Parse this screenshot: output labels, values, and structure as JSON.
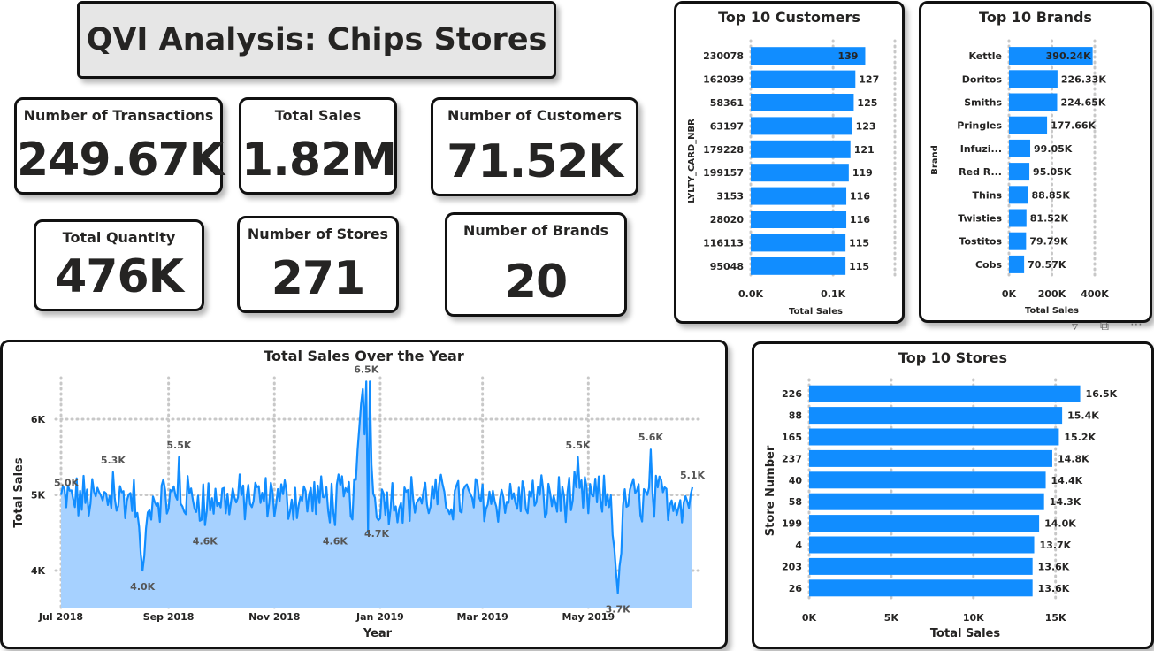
{
  "header": {
    "title": "QVI Analysis: Chips Stores"
  },
  "kpis": {
    "transactions": {
      "label": "Number of Transactions",
      "value": "249.67K"
    },
    "sales": {
      "label": "Total Sales",
      "value": "1.82M"
    },
    "customers": {
      "label": "Number of Customers",
      "value": "71.52K"
    },
    "quantity": {
      "label": "Total Quantity",
      "value": "476K"
    },
    "stores": {
      "label": "Number of Stores",
      "value": "271"
    },
    "brands": {
      "label": "Number of Brands",
      "value": "20"
    }
  },
  "colors": {
    "bar": "#118DFF",
    "area": "#A6D1FF",
    "grid": "#C8C8C8",
    "text": "#252423",
    "border": "#111111"
  },
  "icons": [
    "filter-icon",
    "focus-mode-icon",
    "more-options-icon"
  ],
  "chart_data": [
    {
      "id": "top_customers",
      "type": "bar",
      "orientation": "horizontal",
      "title": "Top 10 Customers",
      "xlabel": "Total Sales",
      "ylabel": "LYLTY_CARD_NBR",
      "categories": [
        "230078",
        "162039",
        "58361",
        "63197",
        "179228",
        "199157",
        "3153",
        "28020",
        "116113",
        "95048"
      ],
      "values": [
        139,
        127,
        125,
        123,
        121,
        119,
        116,
        116,
        115,
        115
      ],
      "labels": [
        "139",
        "127",
        "125",
        "123",
        "121",
        "119",
        "116",
        "116",
        "115",
        "115"
      ],
      "xticks": [
        "0.0K",
        "0.1K"
      ],
      "xlim": [
        0,
        175
      ]
    },
    {
      "id": "top_brands",
      "type": "bar",
      "orientation": "horizontal",
      "title": "Top 10 Brands",
      "xlabel": "Total Sales",
      "ylabel": "Brand",
      "categories": [
        "Kettle",
        "Doritos",
        "Smiths",
        "Pringles",
        "Infuzi...",
        "Red R...",
        "Thins",
        "Twisties",
        "Tostitos",
        "Cobs"
      ],
      "values": [
        390240,
        226330,
        224650,
        177660,
        99050,
        95050,
        88850,
        81520,
        79790,
        70570
      ],
      "labels": [
        "390.24K",
        "226.33K",
        "224.65K",
        "177.66K",
        "99.05K",
        "95.05K",
        "88.85K",
        "81.52K",
        "79.79K",
        "70.57K"
      ],
      "xticks": [
        "0K",
        "200K",
        "400K"
      ],
      "xlim": [
        0,
        400000
      ]
    },
    {
      "id": "sales_over_year",
      "type": "area",
      "title": "Total Sales Over the Year",
      "xlabel": "Year",
      "ylabel": "Total Sales",
      "xticks": [
        "Jul 2018",
        "Sep 2018",
        "Nov 2018",
        "Jan 2019",
        "Mar 2019",
        "May 2019"
      ],
      "yticks": [
        "4K",
        "5K",
        "6K"
      ],
      "ylim": [
        3500,
        6900
      ],
      "date_range": [
        "2018-07-01",
        "2019-06-30"
      ],
      "annotations": [
        {
          "date": "2018-07-01",
          "label": "5.0K",
          "value": 5000
        },
        {
          "date": "2018-07-31",
          "label": "5.3K",
          "value": 5300
        },
        {
          "date": "2018-08-17",
          "label": "4.0K",
          "value": 4000
        },
        {
          "date": "2018-09-07",
          "label": "5.5K",
          "value": 5500
        },
        {
          "date": "2018-09-22",
          "label": "4.6K",
          "value": 4600
        },
        {
          "date": "2018-12-06",
          "label": "4.6K",
          "value": 4600
        },
        {
          "date": "2018-12-24",
          "label": "6.5K",
          "value": 6500
        },
        {
          "date": "2018-12-30",
          "label": "4.7K",
          "value": 4700
        },
        {
          "date": "2019-04-25",
          "label": "5.5K",
          "value": 5500
        },
        {
          "date": "2019-05-18",
          "label": "3.7K",
          "value": 3700
        },
        {
          "date": "2019-06-06",
          "label": "5.6K",
          "value": 5600
        },
        {
          "date": "2019-06-30",
          "label": "5.1K",
          "value": 5100
        }
      ]
    },
    {
      "id": "top_stores",
      "type": "bar",
      "orientation": "horizontal",
      "title": "Top 10 Stores",
      "xlabel": "Total Sales",
      "ylabel": "Store Number",
      "categories": [
        "226",
        "88",
        "165",
        "237",
        "40",
        "58",
        "199",
        "4",
        "203",
        "26"
      ],
      "values": [
        16500,
        15400,
        15200,
        14800,
        14400,
        14300,
        14000,
        13700,
        13600,
        13600
      ],
      "labels": [
        "16.5K",
        "15.4K",
        "15.2K",
        "14.8K",
        "14.4K",
        "14.3K",
        "14.0K",
        "13.7K",
        "13.6K",
        "13.6K"
      ],
      "xticks": [
        "0K",
        "5K",
        "10K",
        "15K"
      ],
      "xlim": [
        0,
        19000
      ]
    }
  ]
}
